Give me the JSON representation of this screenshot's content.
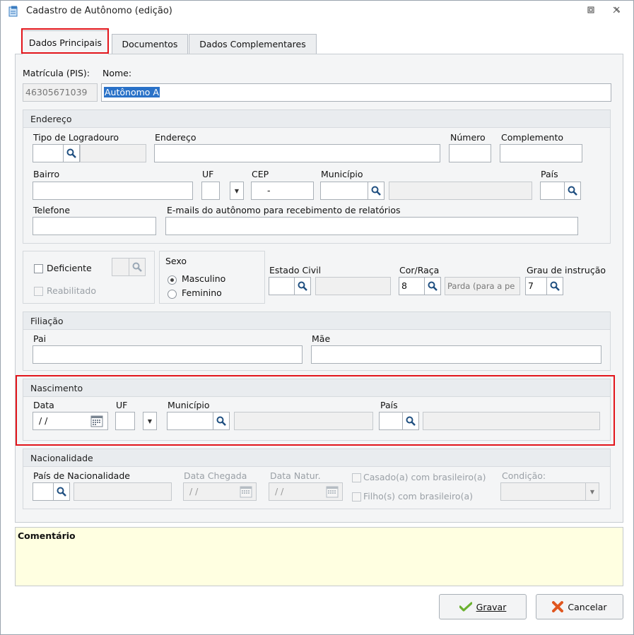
{
  "window": {
    "title": "Cadastro de Autônomo (edição)"
  },
  "tabs": [
    {
      "label": "Dados Principais"
    },
    {
      "label": "Documentos"
    },
    {
      "label": "Dados Complementares"
    }
  ],
  "main": {
    "matricula_label": "Matrícula (PIS):",
    "matricula_value": "46305671039",
    "nome_label": "Nome:",
    "nome_value": "Autônomo A"
  },
  "endereco": {
    "title": "Endereço",
    "tipo_logradouro_label": "Tipo de Logradouro",
    "endereco_label": "Endereço",
    "numero_label": "Número",
    "complemento_label": "Complemento",
    "bairro_label": "Bairro",
    "uf_label": "UF",
    "cep_label": "CEP",
    "cep_value": "-",
    "municipio_label": "Município",
    "pais_label": "País",
    "telefone_label": "Telefone",
    "emails_label": "E-mails do autônomo para recebimento de relatórios"
  },
  "pessoal": {
    "deficiente_label": "Deficiente",
    "reabilitado_label": "Reabilitado",
    "sexo_title": "Sexo",
    "masculino_label": "Masculino",
    "feminino_label": "Feminino",
    "estado_civil_label": "Estado Civil",
    "cor_raca_label": "Cor/Raça",
    "cor_raca_code": "8",
    "cor_raca_desc": "Parda (para a pe",
    "grau_label": "Grau de instrução",
    "grau_code": "7"
  },
  "filiacao": {
    "title": "Filiação",
    "pai_label": "Pai",
    "mae_label": "Mãe"
  },
  "nascimento": {
    "title": "Nascimento",
    "data_label": "Data",
    "data_value": "/ /",
    "uf_label": "UF",
    "municipio_label": "Município",
    "pais_label": "País"
  },
  "nacionalidade": {
    "title": "Nacionalidade",
    "pais_label": "País de Nacionalidade",
    "data_chegada_label": "Data Chegada",
    "data_chegada_value": "/ /",
    "data_natur_label": "Data Natur.",
    "data_natur_value": "/ /",
    "casado_label": "Casado(a) com brasileiro(a)",
    "filho_label": "Filho(s) com brasileiro(a)",
    "condicao_label": "Condição:"
  },
  "comment": {
    "label": "Comentário"
  },
  "buttons": {
    "gravar": "Gravar",
    "cancelar": "Cancelar"
  }
}
